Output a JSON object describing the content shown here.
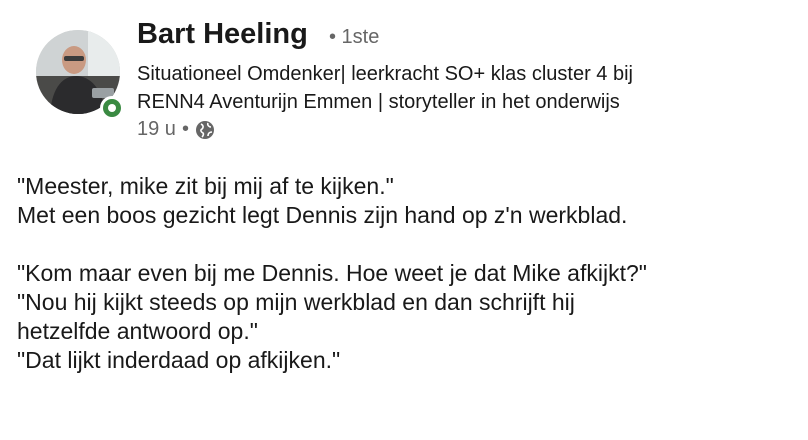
{
  "author": {
    "name": "Bart Heeling",
    "degree": "• 1ste",
    "headline_line1": "Situationeel Omdenker| leerkracht SO+ klas cluster 4 bij",
    "headline_line2": "RENN4 Aventurijn Emmen | storyteller in het onderwijs",
    "online_status_color": "#3a8a42"
  },
  "meta": {
    "time": "19 u",
    "separator": "•",
    "visibility_icon": "globe-icon"
  },
  "post": {
    "lines": [
      "\"Meester, mike zit bij mij af te kijken.\"",
      "Met een boos gezicht legt Dennis zijn hand op z'n werkblad.",
      "\"Kom maar even bij me Dennis. Hoe weet je dat Mike afkijkt?\"",
      "\"Nou hij kijkt steeds op mijn werkblad en dan schrijft hij",
      "hetzelfde antwoord op.\"",
      "\"Dat lijkt inderdaad op afkijken.\""
    ]
  }
}
